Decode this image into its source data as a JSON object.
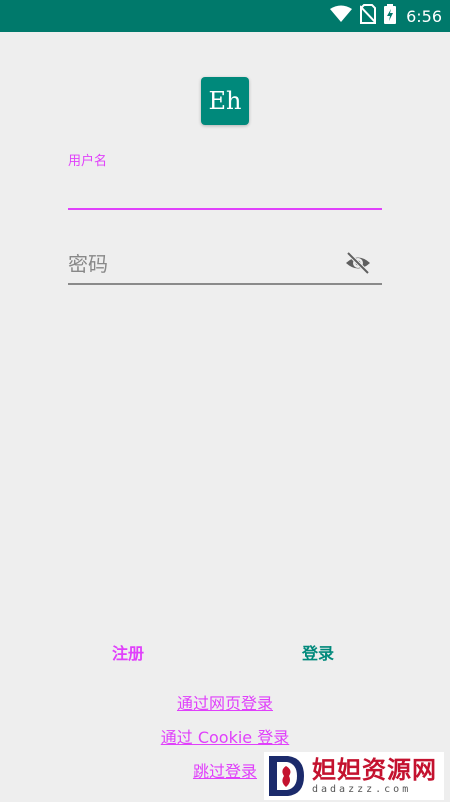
{
  "status_bar": {
    "time": "6:56",
    "icons": [
      "wifi-icon",
      "no-sim-icon",
      "battery-charging-icon"
    ]
  },
  "app": {
    "logo_text": "Eh"
  },
  "form": {
    "username_label": "用户名",
    "username_value": "",
    "password_placeholder": "密码",
    "password_value": ""
  },
  "actions": {
    "register_label": "注册",
    "login_label": "登录"
  },
  "links": {
    "web_login": "通过网页登录",
    "cookie_login": "通过 Cookie 登录",
    "skip_login": "跳过登录"
  },
  "watermark": {
    "title": "妲妲资源网",
    "subtitle": "dadazzz.com"
  },
  "colors": {
    "status_bar": "#00796b",
    "accent": "#e040fb",
    "primary": "#00897b",
    "background": "#eeeeee"
  }
}
